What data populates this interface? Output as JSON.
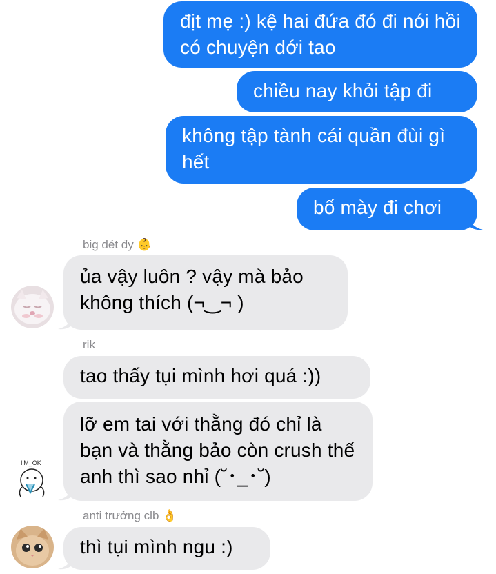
{
  "outgoing": [
    {
      "text": "địt mẹ :) kệ hai đứa đó đi nói hồi có chuyện dới tao"
    },
    {
      "text": "chiều nay khỏi tập đi"
    },
    {
      "text": "không tập tành cái quần đùi gì hết"
    },
    {
      "text": "bố mày đi chơi"
    }
  ],
  "groups": [
    {
      "sender": "big dét đy",
      "emoji": "👶",
      "avatar_icon": "cat-avatar-icon",
      "messages": [
        {
          "text": "ủa vậy luôn ? vậy mà bảo không thích (¬‿¬ )"
        }
      ]
    },
    {
      "sender": "rik",
      "emoji": "",
      "avatar_icon": "im-ok-sticker-avatar-icon",
      "avatar_label": "I'M OK",
      "messages": [
        {
          "text": "tao thấy tụi mình hơi quá :))"
        },
        {
          "text": "lỡ em tai với thằng đó chỉ là bạn và thằng bảo còn crush thế anh thì sao nhỉ (˘･_･˘)"
        }
      ]
    },
    {
      "sender": "anti trưởng clb",
      "emoji": "👌",
      "avatar_icon": "kitten-avatar-icon",
      "messages": [
        {
          "text": "thì tụi mình ngu :)"
        }
      ]
    }
  ],
  "colors": {
    "outgoing_bubble": "#1b7cf4",
    "incoming_bubble": "#e9e9eb",
    "sender_name": "#8a8a8e"
  }
}
